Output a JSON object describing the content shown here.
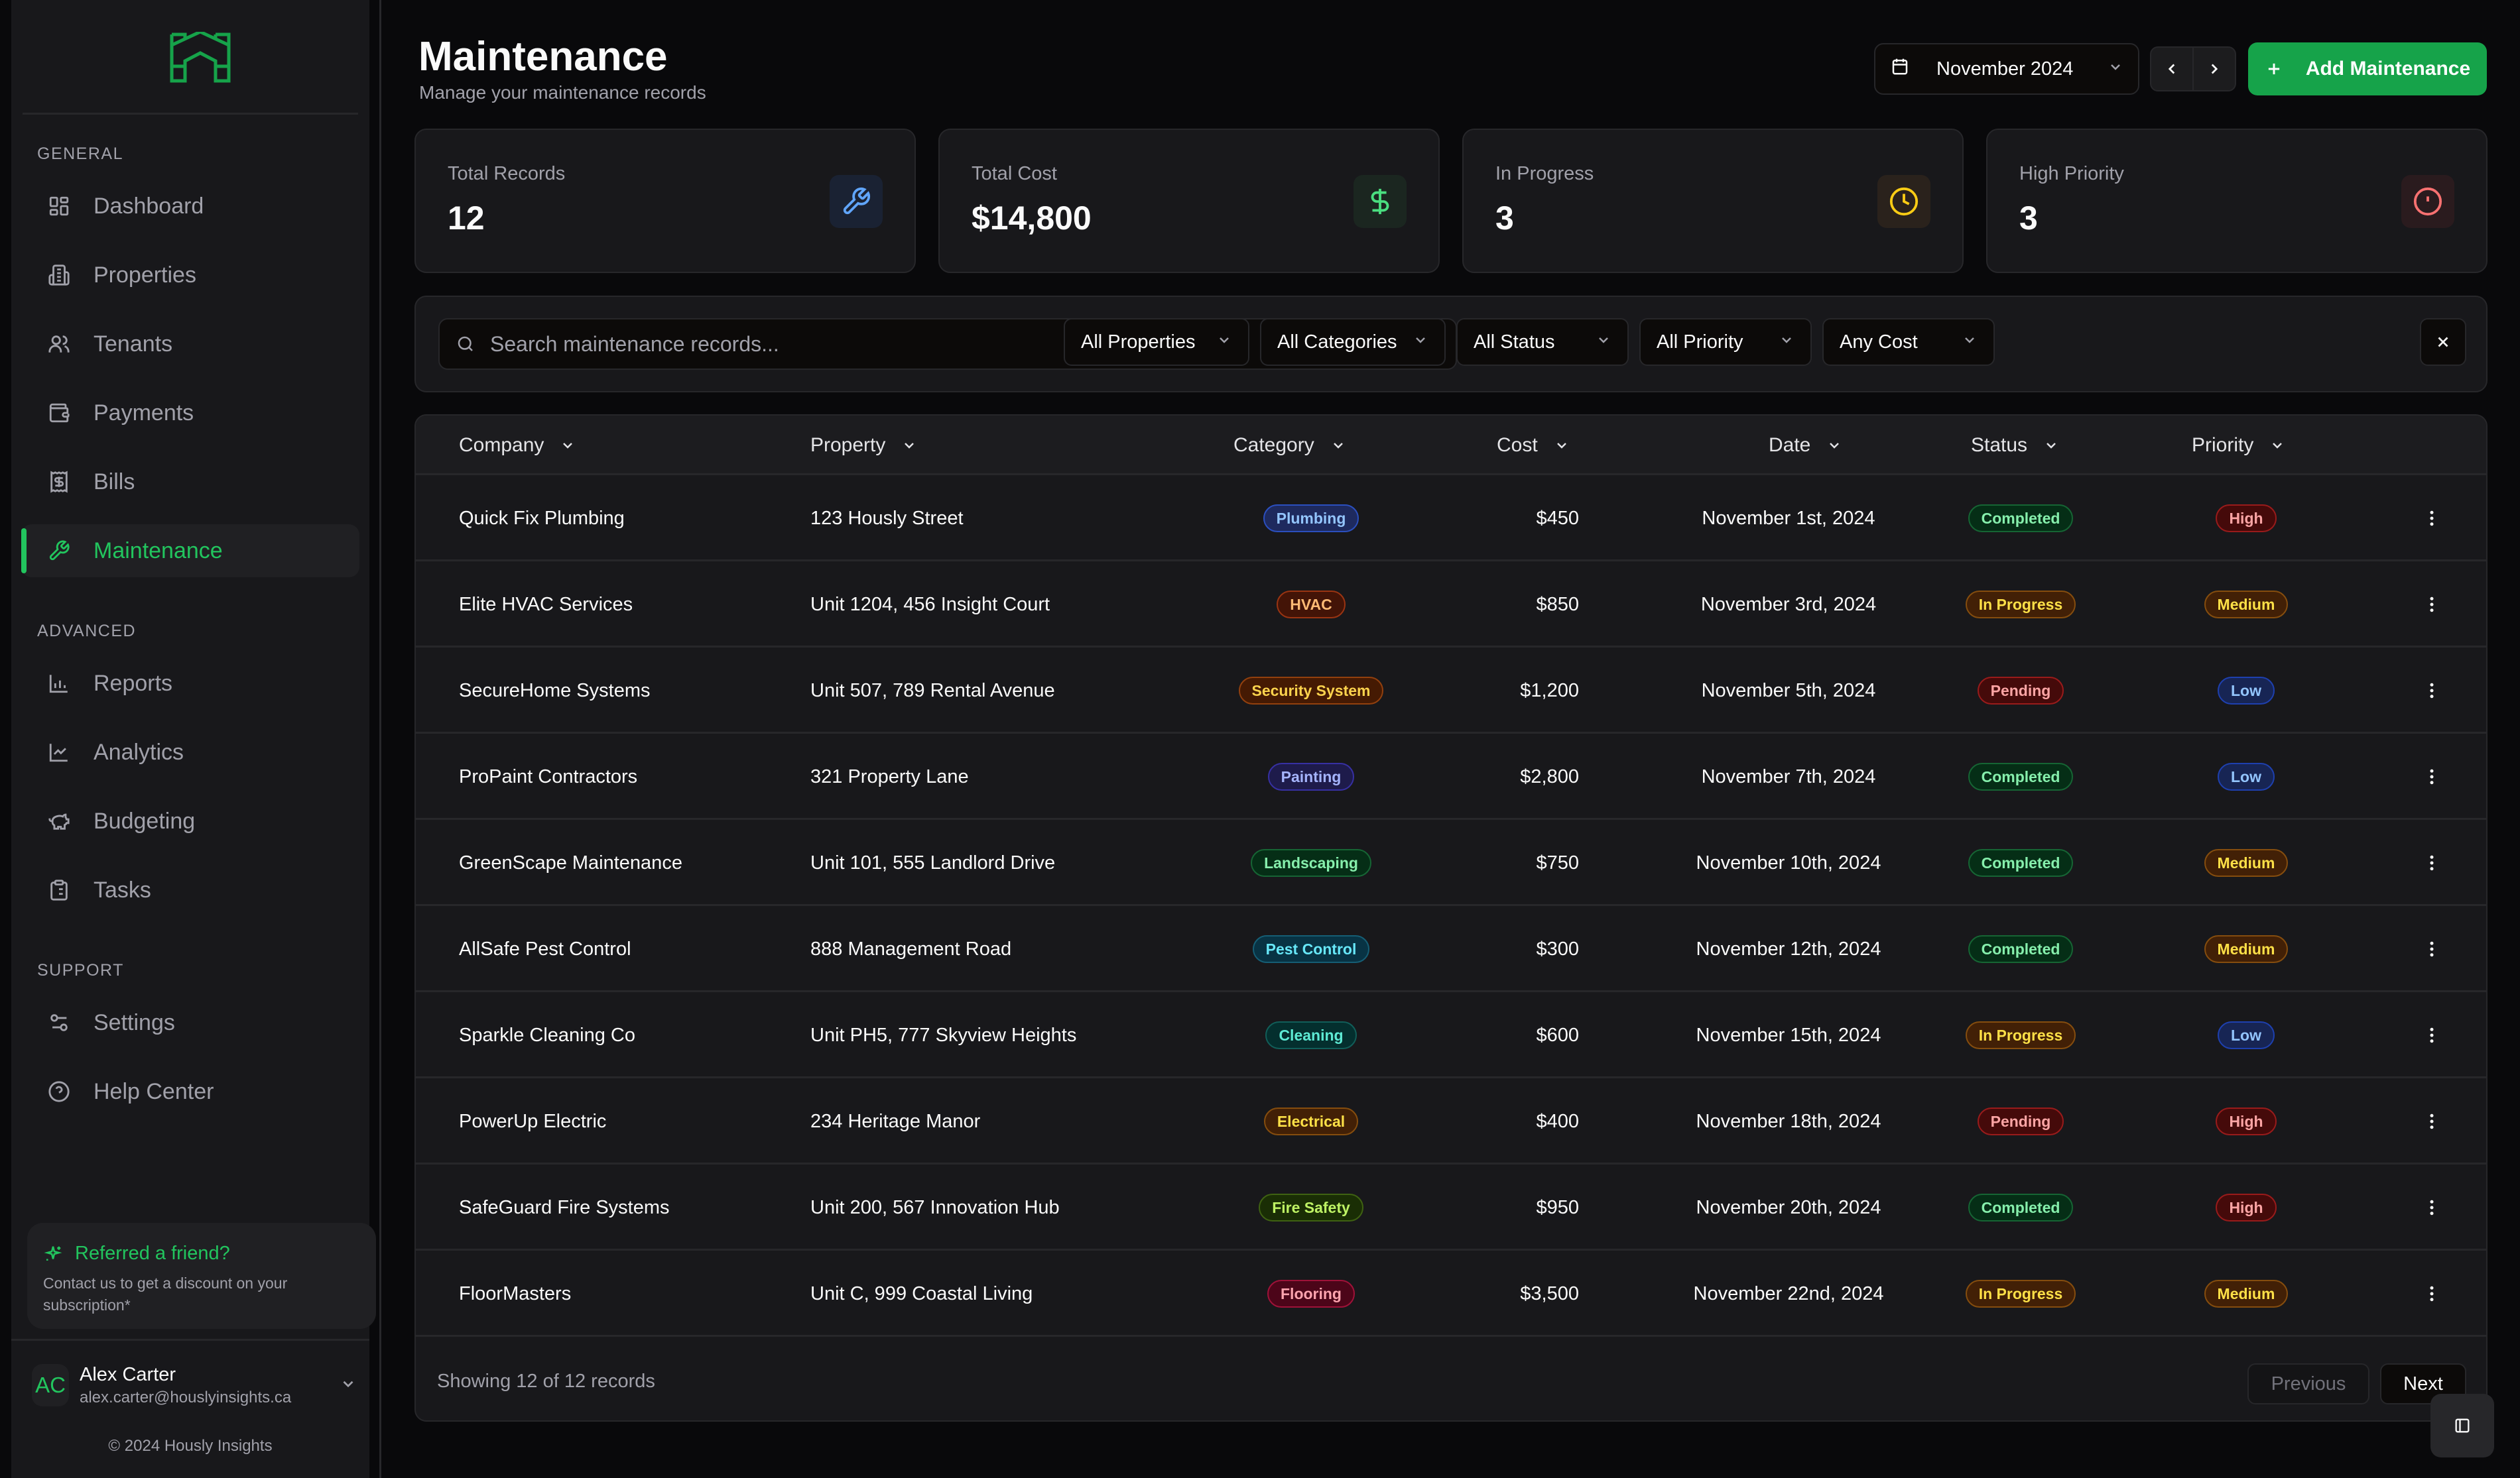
{
  "app": {
    "brand_color": "#22c55e",
    "copyright": "© 2024 Hously Insights"
  },
  "sidebar": {
    "sections": [
      {
        "label": "GENERAL",
        "items": [
          {
            "label": "Dashboard",
            "icon": "dashboard-icon"
          },
          {
            "label": "Properties",
            "icon": "building-icon"
          },
          {
            "label": "Tenants",
            "icon": "users-icon"
          },
          {
            "label": "Payments",
            "icon": "wallet-icon"
          },
          {
            "label": "Bills",
            "icon": "receipt-icon"
          },
          {
            "label": "Maintenance",
            "icon": "wrench-icon",
            "active": true
          }
        ]
      },
      {
        "label": "ADVANCED",
        "items": [
          {
            "label": "Reports",
            "icon": "bar-chart-icon"
          },
          {
            "label": "Analytics",
            "icon": "line-chart-icon"
          },
          {
            "label": "Budgeting",
            "icon": "piggy-bank-icon"
          },
          {
            "label": "Tasks",
            "icon": "clipboard-list-icon"
          }
        ]
      },
      {
        "label": "SUPPORT",
        "items": [
          {
            "label": "Settings",
            "icon": "sliders-icon"
          },
          {
            "label": "Help Center",
            "icon": "help-circle-icon"
          }
        ]
      }
    ],
    "referral": {
      "title": "Referred a friend?",
      "text": "Contact us to get a discount on your subscription*"
    },
    "user": {
      "initials": "AC",
      "name": "Alex Carter",
      "email": "alex.carter@houslyinsights.ca"
    }
  },
  "header": {
    "title": "Maintenance",
    "subtitle": "Manage your maintenance records",
    "month": "November 2024",
    "add_label": "Add Maintenance"
  },
  "stats": [
    {
      "label": "Total Records",
      "value": "12",
      "icon": "wrench-icon",
      "color": "#60a5fa",
      "bg": "#1a2233"
    },
    {
      "label": "Total Cost",
      "value": "$14,800",
      "icon": "dollar-icon",
      "color": "#4ade80",
      "bg": "#1b2620"
    },
    {
      "label": "In Progress",
      "value": "3",
      "icon": "clock-icon",
      "color": "#facc15",
      "bg": "#2a221c"
    },
    {
      "label": "High Priority",
      "value": "3",
      "icon": "alert-circle-icon",
      "color": "#f87171",
      "bg": "#2a1b1e"
    }
  ],
  "filters": {
    "search_placeholder": "Search maintenance records...",
    "search_value": "",
    "selects": [
      "All Properties",
      "All Categories",
      "All Status",
      "All Priority",
      "Any Cost"
    ]
  },
  "table": {
    "columns": [
      "Company",
      "Property",
      "Category",
      "Cost",
      "Date",
      "Status",
      "Priority"
    ],
    "rows": [
      {
        "company": "Quick Fix Plumbing",
        "property": "123 Hously Street",
        "category": "Plumbing",
        "cost": "$450",
        "date": "November 1st, 2024",
        "status": "Completed",
        "priority": "High"
      },
      {
        "company": "Elite HVAC Services",
        "property": "Unit 1204, 456 Insight Court",
        "category": "HVAC",
        "cost": "$850",
        "date": "November 3rd, 2024",
        "status": "In Progress",
        "priority": "Medium"
      },
      {
        "company": "SecureHome Systems",
        "property": "Unit 507, 789 Rental Avenue",
        "category": "Security System",
        "cost": "$1,200",
        "date": "November 5th, 2024",
        "status": "Pending",
        "priority": "Low"
      },
      {
        "company": "ProPaint Contractors",
        "property": "321 Property Lane",
        "category": "Painting",
        "cost": "$2,800",
        "date": "November 7th, 2024",
        "status": "Completed",
        "priority": "Low"
      },
      {
        "company": "GreenScape Maintenance",
        "property": "Unit 101, 555 Landlord Drive",
        "category": "Landscaping",
        "cost": "$750",
        "date": "November 10th, 2024",
        "status": "Completed",
        "priority": "Medium"
      },
      {
        "company": "AllSafe Pest Control",
        "property": "888 Management Road",
        "category": "Pest Control",
        "cost": "$300",
        "date": "November 12th, 2024",
        "status": "Completed",
        "priority": "Medium"
      },
      {
        "company": "Sparkle Cleaning Co",
        "property": "Unit PH5, 777 Skyview Heights",
        "category": "Cleaning",
        "cost": "$600",
        "date": "November 15th, 2024",
        "status": "In Progress",
        "priority": "Low"
      },
      {
        "company": "PowerUp Electric",
        "property": "234 Heritage Manor",
        "category": "Electrical",
        "cost": "$400",
        "date": "November 18th, 2024",
        "status": "Pending",
        "priority": "High"
      },
      {
        "company": "SafeGuard Fire Systems",
        "property": "Unit 200, 567 Innovation Hub",
        "category": "Fire Safety",
        "cost": "$950",
        "date": "November 20th, 2024",
        "status": "Completed",
        "priority": "High"
      },
      {
        "company": "FloorMasters",
        "property": "Unit C, 999 Coastal Living",
        "category": "Flooring",
        "cost": "$3,500",
        "date": "November 22nd, 2024",
        "status": "In Progress",
        "priority": "Medium"
      }
    ],
    "footer_text": "Showing 12 of 12 records",
    "prev_label": "Previous",
    "next_label": "Next"
  },
  "badge_colors": {
    "category": {
      "Plumbing": {
        "fg": "#93c5fd",
        "bg": "#1e2a5e",
        "border": "#2b4fbf"
      },
      "HVAC": {
        "fg": "#fdba74",
        "bg": "#431407",
        "border": "#9a3412"
      },
      "Security System": {
        "fg": "#fcd34d",
        "bg": "#451a03",
        "border": "#92400e"
      },
      "Painting": {
        "fg": "#a5b4fc",
        "bg": "#1e1b4b",
        "border": "#3730a3"
      },
      "Landscaping": {
        "fg": "#86efac",
        "bg": "#052e16",
        "border": "#166534"
      },
      "Pest Control": {
        "fg": "#67e8f9",
        "bg": "#083344",
        "border": "#155e75"
      },
      "Cleaning": {
        "fg": "#5eead4",
        "bg": "#042f2e",
        "border": "#115e59"
      },
      "Electrical": {
        "fg": "#fde047",
        "bg": "#422006",
        "border": "#854d0e"
      },
      "Fire Safety": {
        "fg": "#bef264",
        "bg": "#1a2e05",
        "border": "#3f6212"
      },
      "Flooring": {
        "fg": "#fda4af",
        "bg": "#4c0519",
        "border": "#9f1239"
      }
    },
    "status": {
      "Completed": {
        "fg": "#86efac",
        "bg": "#052e16",
        "border": "#166534"
      },
      "In Progress": {
        "fg": "#fde047",
        "bg": "#422006",
        "border": "#854d0e"
      },
      "Pending": {
        "fg": "#fca5a5",
        "bg": "#450a0a",
        "border": "#991b1b"
      }
    },
    "priority": {
      "High": {
        "fg": "#fca5a5",
        "bg": "#450a0a",
        "border": "#991b1b"
      },
      "Medium": {
        "fg": "#fde047",
        "bg": "#422006",
        "border": "#854d0e"
      },
      "Low": {
        "fg": "#93c5fd",
        "bg": "#172554",
        "border": "#1e40af"
      }
    }
  }
}
